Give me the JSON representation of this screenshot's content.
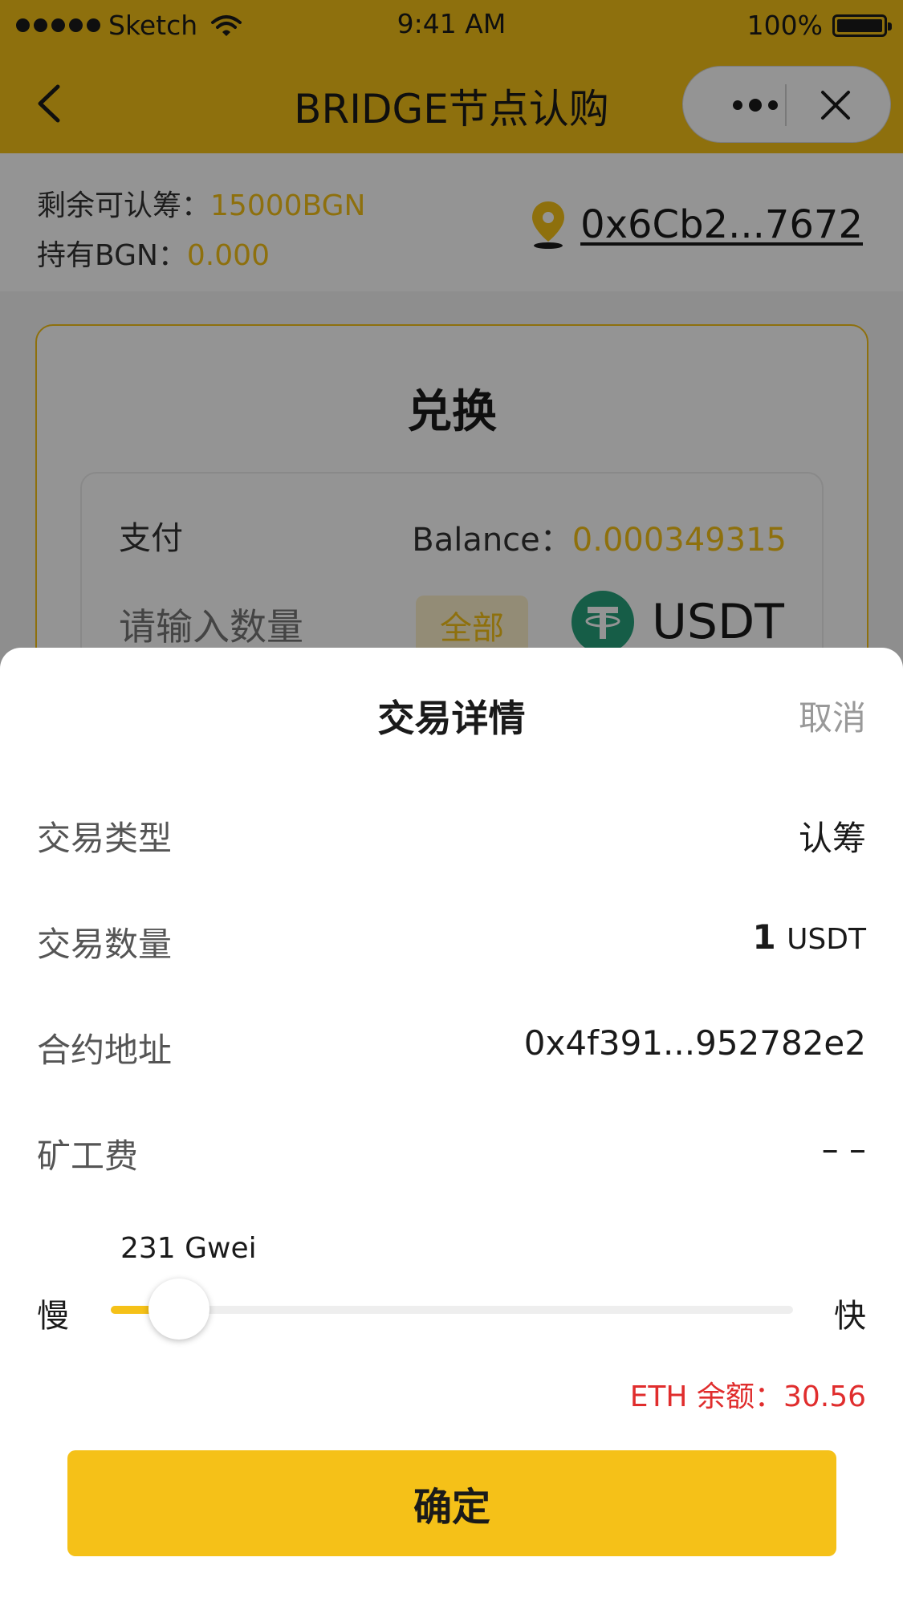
{
  "status_bar": {
    "carrier": "Sketch",
    "time": "9:41 AM",
    "battery": "100%"
  },
  "nav": {
    "title": "BRIDGE节点认购",
    "icons": {
      "back": "back-chevron-icon",
      "more": "more-dots-icon",
      "close": "close-icon"
    }
  },
  "info": {
    "remaining_label": "剩余可认筹：",
    "remaining_value": "15000BGN",
    "holding_label": "持有BGN：",
    "holding_value": "0.000",
    "address": "0x6Cb2...7672"
  },
  "swap": {
    "title": "兑换",
    "pay_label": "支付",
    "balance_label": "Balance：",
    "balance_value": "0.000349315",
    "amount_placeholder": "请输入数量",
    "all_button": "全部",
    "token": "USDT"
  },
  "sheet": {
    "title": "交易详情",
    "cancel": "取消",
    "rows": [
      {
        "label": "交易类型",
        "value": "认筹"
      },
      {
        "label": "交易数量",
        "value": "1",
        "unit": "USDT"
      },
      {
        "label": "合约地址",
        "value": "0x4f391...952782e2"
      },
      {
        "label": "矿工费",
        "value": "– –"
      }
    ],
    "gas": {
      "value_label": "231 Gwei",
      "slow": "慢",
      "fast": "快",
      "level": 0.1
    },
    "eth_balance": "ETH 余额：30.56",
    "confirm": "确定"
  },
  "colors": {
    "accent": "#f5c118",
    "error": "#e02d2d",
    "usdt": "#26a17b"
  }
}
